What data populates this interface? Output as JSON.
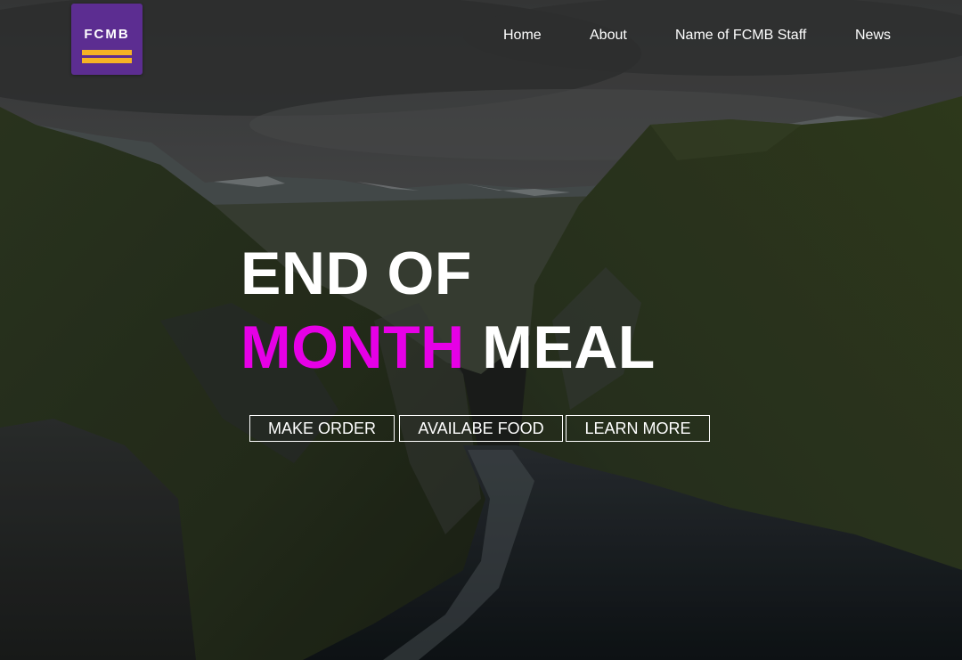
{
  "brand": {
    "logo_text": "FCMB",
    "logo_color": "#5c2d91",
    "logo_bar_color": "#f5b324"
  },
  "nav": {
    "items": [
      {
        "label": "Home"
      },
      {
        "label": "About"
      },
      {
        "label": "Name of FCMB Staff"
      },
      {
        "label": "News"
      }
    ]
  },
  "hero": {
    "line1": "END OF",
    "line2_accent": "MONTH",
    "line2_rest": "MEAL",
    "accent_color": "#e600e6",
    "background": "mountain fjord landscape",
    "buttons": [
      {
        "label": "MAKE ORDER"
      },
      {
        "label": "AVAILABE FOOD"
      },
      {
        "label": "LEARN MORE"
      }
    ]
  }
}
